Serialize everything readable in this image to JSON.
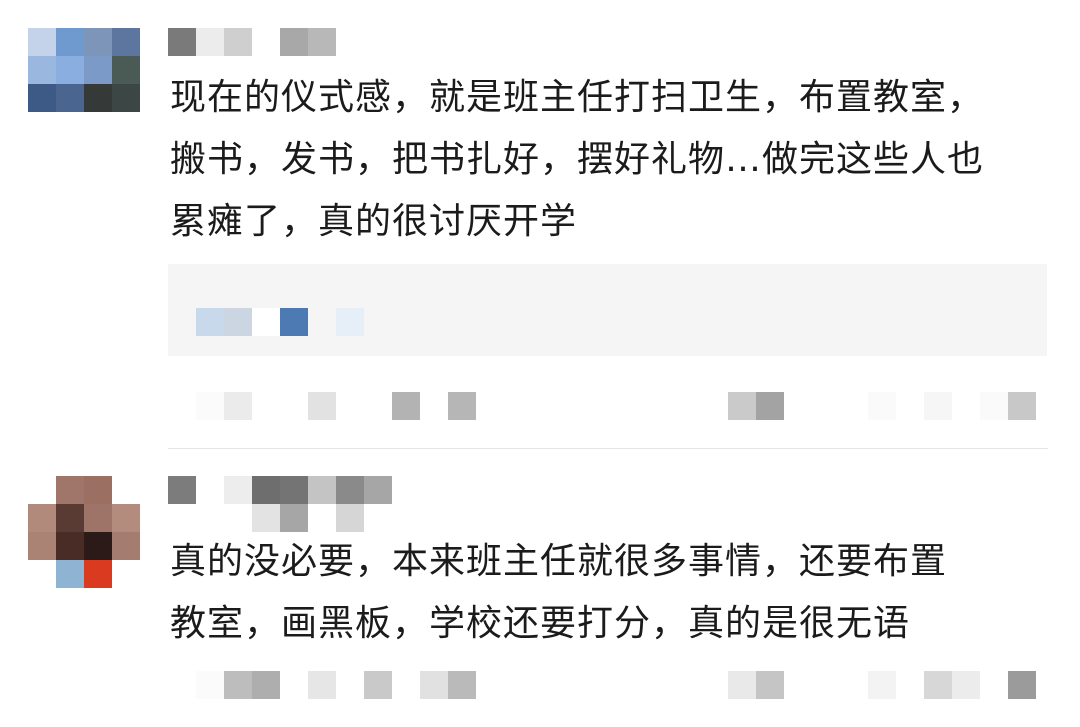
{
  "comments": [
    {
      "author": "",
      "text": "现在的仪式感，就是班主任打扫卫生，布置教室，\n搬书，发书，把书扎好，摆好礼物…做完这些人也\n累瘫了，真的很讨厌开学",
      "avatar_pixels": [
        "#c4d3ea",
        "#6f9ad0",
        "#7d95b8",
        "#5d76a0",
        "#9ab7df",
        "#8aaee0",
        "#7c9ac8",
        "#4a5a55",
        "#3d5a86",
        "#4a6590",
        "#353a38",
        "#3c4745"
      ],
      "name_pixels": [
        "#7a7a7a",
        "#ececec",
        "#cfcfcf",
        "#ffffff",
        "#a8a8a8",
        "#b8b8b8"
      ],
      "reply_pixels": [
        "#c9d9ec",
        "#cbd6e2",
        "#ffffff",
        "#4d7ab2",
        "#e6eef7"
      ],
      "footer_pixels": [
        "#fbfbfb",
        "#ebebeb",
        "#ffffff",
        "#e2e2e2",
        "#b3b3b3",
        "#ffffff",
        "#b6b6b6",
        "#cacaca",
        "#a3a3a3",
        "#fafafa",
        "#f6f6f6",
        "#fafafa",
        "#c8c8c8"
      ]
    },
    {
      "author": "",
      "text": "真的没必要，本来班主任就很多事情，还要布置\n教室，画黑板，学校还要打分，真的是很无语",
      "avatar_pixels": [
        "#ffffff",
        "#a0766a",
        "#9b6f62",
        "#ffffff",
        "#b28a7c",
        "#5a3b33",
        "#9f7468",
        "#b48c7d",
        "#ab8375",
        "#4a2c27",
        "#2b1a18",
        "#a57c70",
        "#ffffff",
        "#8fb3d2",
        "#d93a20",
        "#ffffff"
      ],
      "name_pixels": [
        "#7c7c7c",
        "#ffffff",
        "#ededed",
        "#6e6e6e",
        "#747474",
        "#c4c4c4",
        "#8a8a8a",
        "#a6a6a6"
      ],
      "name_pixels_2": [
        "#e3e3e3",
        "#a6a6a6",
        "#ffffff",
        "#d6d6d6"
      ],
      "footer_pixels": [
        "#fbfbfb",
        "#bdbdbd",
        "#aeaeae",
        "#e6e6e6",
        "#c9c9c9",
        "#e1e1e1",
        "#bababa",
        "#e9e9e9",
        "#c5c5c5",
        "#f3f3f3",
        "#d7d7d7",
        "#ececec",
        "#9b9b9b"
      ]
    }
  ]
}
